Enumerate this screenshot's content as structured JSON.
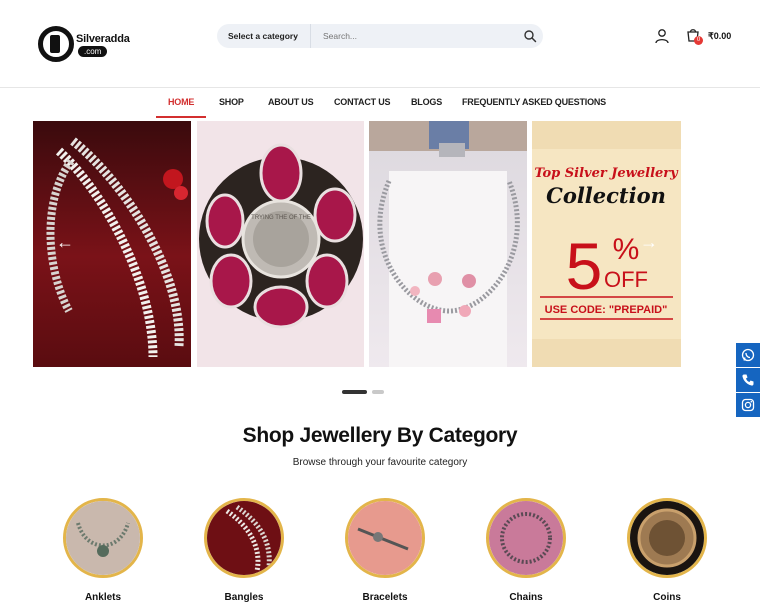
{
  "brand": {
    "name": "Silveradda",
    "suffix": ".com"
  },
  "search": {
    "category_label": "Select a category",
    "placeholder": "Search..."
  },
  "cart": {
    "count": "0",
    "total": "₹0.00"
  },
  "nav": {
    "items": [
      {
        "label": "HOME",
        "active": true
      },
      {
        "label": "SHOP"
      },
      {
        "label": "ABOUT US"
      },
      {
        "label": "CONTACT US"
      },
      {
        "label": "BLOGS"
      },
      {
        "label": "FREQUENTLY ASKED QUESTIONS"
      }
    ]
  },
  "banner": {
    "headline_top": "Top Silver Jewellery",
    "headline_main": "Collection",
    "discount_number": "5",
    "discount_percent": "%",
    "discount_off": "OFF",
    "code_text": "USE CODE: \"PREPAID\"",
    "ring_text": "TRYING THE OF THE"
  },
  "section": {
    "title": "Shop Jewellery By Category",
    "subtitle": "Browse through your favourite category"
  },
  "categories": [
    {
      "label": "Anklets"
    },
    {
      "label": "Bangles"
    },
    {
      "label": "Bracelets"
    },
    {
      "label": "Chains"
    },
    {
      "label": "Coins"
    }
  ],
  "colors": {
    "accent": "#d32f2f",
    "gold_ring": "#e3b54a",
    "side_buttons": "#1565c0",
    "search_bg": "#eef1f6"
  },
  "icons": {
    "search": "search-icon",
    "user": "user-icon",
    "cart": "cart-icon",
    "whatsapp": "whatsapp-icon",
    "phone": "phone-icon",
    "instagram": "instagram-icon"
  }
}
